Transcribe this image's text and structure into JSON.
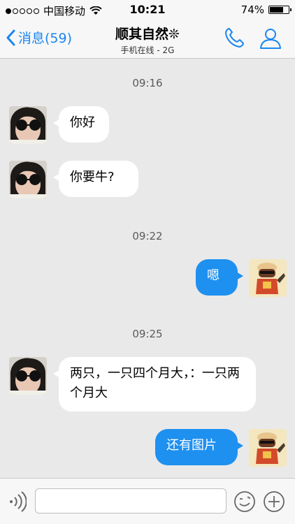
{
  "status_bar": {
    "carrier": "中国移动",
    "time": "10:21",
    "battery_percent": "74%",
    "battery_level": 0.74
  },
  "nav": {
    "back_label": "消息(59)",
    "title": "顺其自然❊",
    "subtitle": "手机在线 - 2G"
  },
  "messages": {
    "t1": "09:16",
    "m1": "你好",
    "m2": "你要牛?",
    "t2": "09:22",
    "m3": "嗯",
    "t3": "09:25",
    "m4": "两只，一只四个月大，：一只两个月大",
    "m5": "还有图片"
  },
  "colors": {
    "accent": "#1a86f1",
    "outgoing_bubble": "#1e90f0",
    "background": "#e9e9e9"
  },
  "icons": {
    "voice": "voice-wave-icon",
    "emoji": "emoji-icon",
    "plus": "plus-icon",
    "phone": "phone-icon",
    "profile": "person-icon"
  }
}
